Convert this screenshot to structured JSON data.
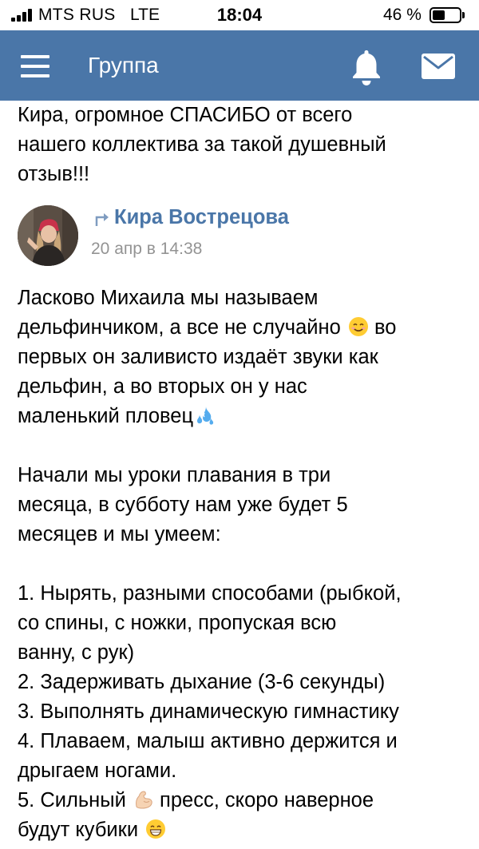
{
  "status_bar": {
    "carrier": "MTS RUS",
    "network": "LTE",
    "time": "18:04",
    "battery_percent": "46 %",
    "battery_level": 0.46
  },
  "header": {
    "title": "Группа",
    "background_color": "#4a76a8",
    "icons": [
      "menu-icon",
      "bell-icon",
      "mail-icon"
    ]
  },
  "reply": {
    "lines": [
      "Кира, огромное СПАСИБО от всего",
      "нашего коллектива за такой душевный",
      "отзыв!!!"
    ]
  },
  "post": {
    "author": "Кира Вострецова",
    "author_color": "#4a76a8",
    "date": "20 апр в 14:38",
    "repost_icon": "repost-arrow-icon",
    "paragraph1": [
      "Ласково Михаила мы называем",
      "дельфинчиком, а все не случайно",
      "во",
      "первых он заливисто издаёт звуки как",
      "дельфин, а во вторых он у нас",
      "маленький пловец"
    ],
    "paragraph2": [
      "Начали мы уроки плавания в три",
      "месяца, в субботу нам уже будет 5",
      "месяцев и мы умеем:"
    ],
    "list": [
      "1. Нырять, разными способами (рыбкой,",
      "со спины, с ножки, пропуская всю",
      "ванну, с рук)",
      "2. Задерживать дыхание (3-6 секунды)",
      "3. Выполнять динамическую гимнастику",
      "4. Плаваем, малыш активно держится и",
      "дрыгаем ногами.",
      "5. Сильный",
      "пресс, скоро наверное",
      "будут кубики"
    ],
    "emojis": [
      "smiling-face-emoji",
      "sweat-droplets-emoji",
      "flexed-biceps-emoji",
      "grinning-face-emoji"
    ]
  }
}
